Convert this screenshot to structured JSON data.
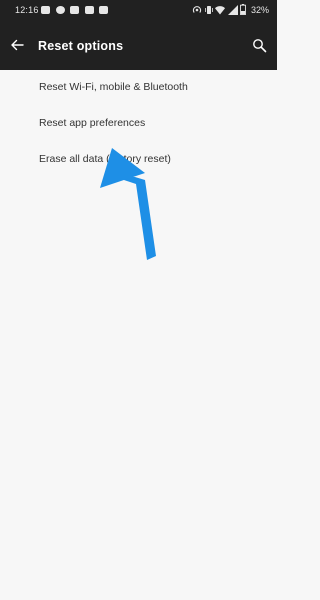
{
  "status_bar": {
    "time": "12:16",
    "notification_icons": [
      "youtube-icon",
      "facebook-icon",
      "youtube-icon",
      "youtube-icon",
      "app-icon"
    ],
    "battery_percent": "32%"
  },
  "toolbar": {
    "title": "Reset options"
  },
  "options": [
    {
      "label": "Reset Wi-Fi, mobile & Bluetooth"
    },
    {
      "label": "Reset app preferences"
    },
    {
      "label": "Erase all data (factory reset)"
    }
  ],
  "colors": {
    "bar_background": "#212121",
    "page_background": "#f7f7f7",
    "text": "#333333",
    "annotation_arrow": "#1e8fe6"
  }
}
